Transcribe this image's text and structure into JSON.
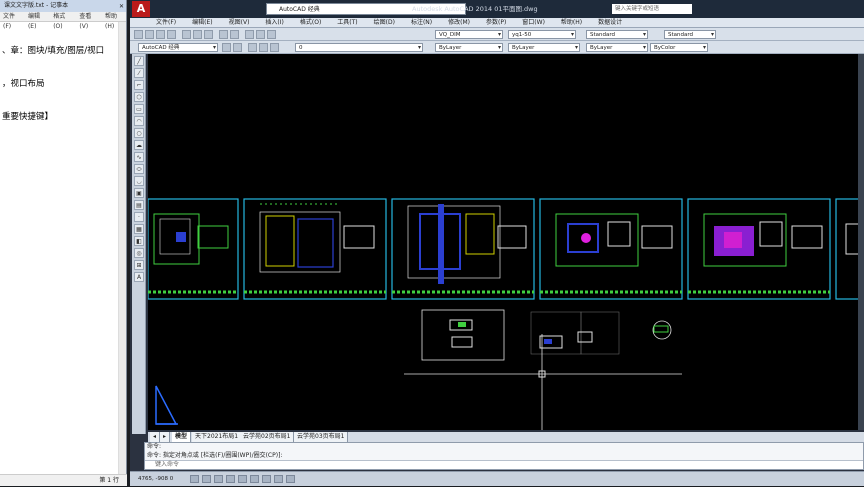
{
  "notepad": {
    "title": "课文文字版.txt - 记事本",
    "menu": [
      "文件(F)",
      "编辑(E)",
      "格式(O)",
      "查看(V)",
      "帮助(H)"
    ],
    "lines": [
      "、章：图块/填充/图层/视口",
      "，视口布局",
      "重要快捷键】"
    ],
    "status": "第 1 行"
  },
  "acad": {
    "logo": "A",
    "workspace": "AutoCAD 经典",
    "title": "Autodesk AutoCAD 2014    01平面图.dwg",
    "search_placeholder": "键入关键字或短语",
    "menu": [
      "文件(F)",
      "编辑(E)",
      "视图(V)",
      "插入(I)",
      "格式(O)",
      "工具(T)",
      "绘图(D)",
      "标注(N)",
      "修改(M)",
      "参数(P)",
      "窗口(W)",
      "帮助(H)",
      "数据设计"
    ],
    "toolbar1": {
      "text_style": "VQ_DIM",
      "dim_style": "yq1-50",
      "table_style": "Standard",
      "ml_style": "Standard"
    },
    "toolbar2": {
      "workspace": "AutoCAD 经典",
      "layer": "0",
      "color": "ByLayer",
      "linetype": "ByLayer",
      "lineweight": "ByLayer",
      "plot_style": "ByColor"
    },
    "tabs": [
      "模型",
      "天下2021布局1",
      "云学苑02页布局1",
      "云学苑03页布局1"
    ],
    "command": {
      "history1": "命令:",
      "history2": "命令: 指定对角点或 [栏选(F)/圈围(WP)/圈交(CP)]:",
      "prompt": "键入命令"
    },
    "status_coords": "4765, -908  0"
  },
  "colors": {
    "canvas": "#000000",
    "frame": "#25b7e0",
    "acad_red": "#ba1b1b"
  }
}
